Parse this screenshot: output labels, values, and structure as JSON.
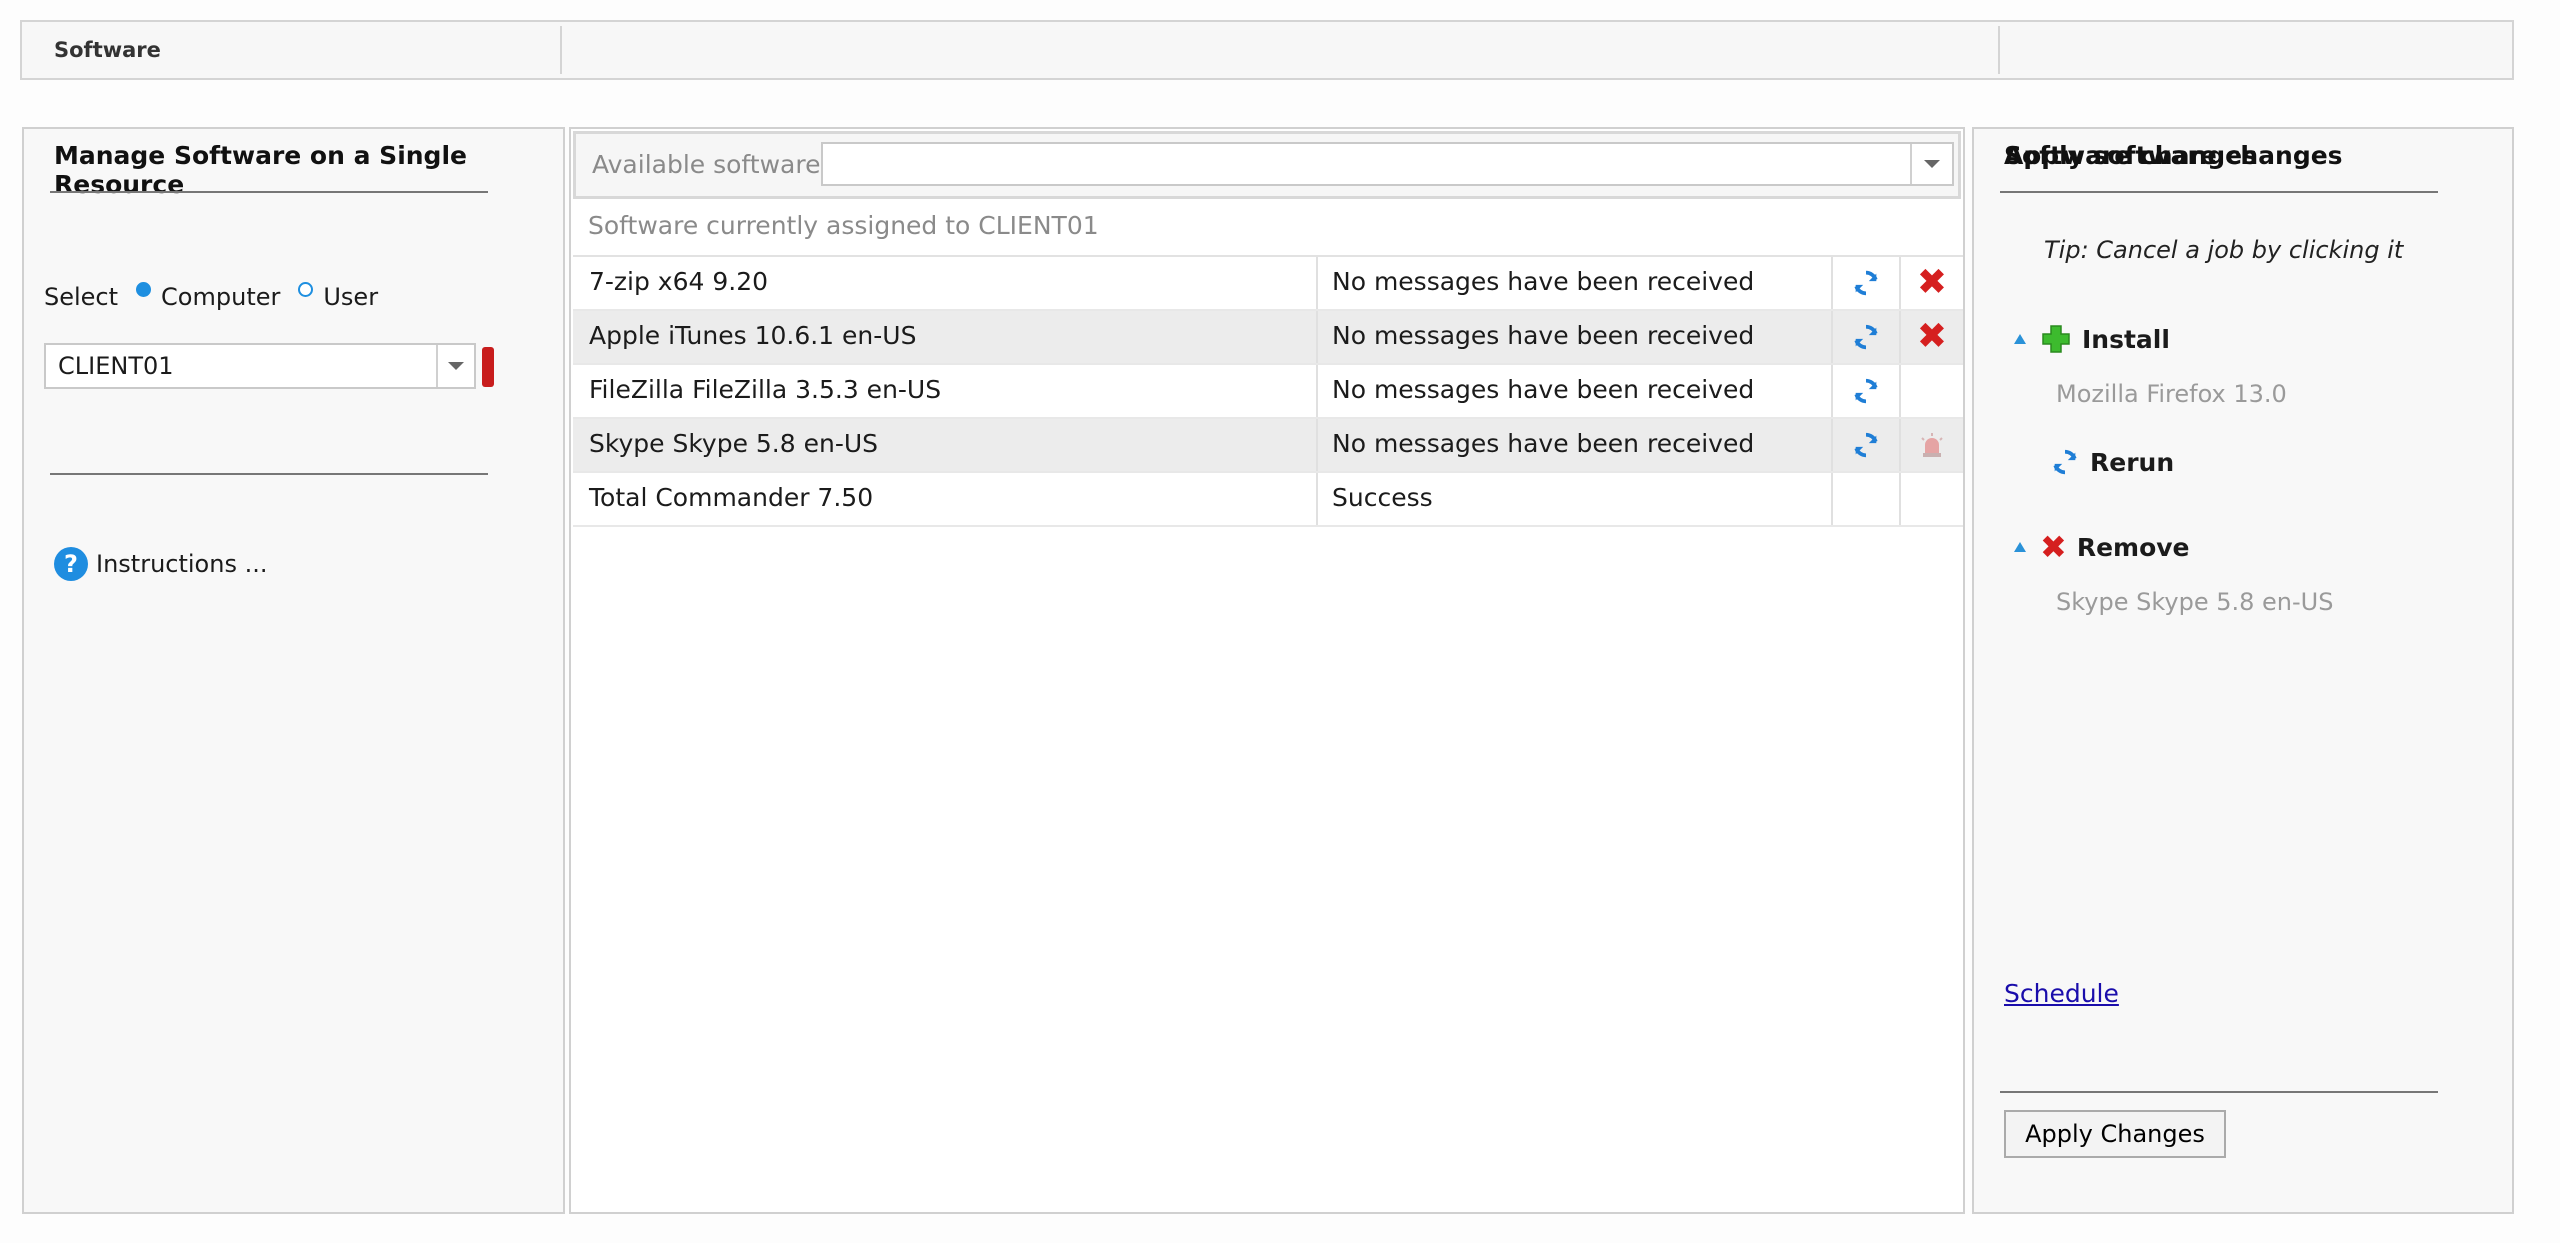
{
  "topbar": {
    "title": "Software"
  },
  "left": {
    "heading": "Manage Software on a Single Resource",
    "select_label": "Select",
    "radio_computer": "Computer",
    "radio_user": "User",
    "resource_value": "CLIENT01",
    "instructions": "Instructions ..."
  },
  "middle": {
    "available_label": "Available software",
    "available_value": "",
    "assigned_caption": "Software currently assigned to CLIENT01",
    "rows": [
      {
        "name": "7-zip x64 9.20",
        "status": "No messages have been received"
      },
      {
        "name": "Apple iTunes 10.6.1 en-US",
        "status": "No messages have been received"
      },
      {
        "name": "FileZilla FileZilla 3.5.3 en-US",
        "status": "No messages have been received"
      },
      {
        "name": "Skype Skype 5.8 en-US",
        "status": "No messages have been received"
      },
      {
        "name": "Total Commander 7.50",
        "status": "Success"
      }
    ]
  },
  "right": {
    "heading": "Software changes",
    "tip": "Tip: Cancel a job by clicking it",
    "install_label": "Install",
    "install_item": "Mozilla Firefox 13.0",
    "rerun_label": "Rerun",
    "remove_label": "Remove",
    "remove_item": "Skype Skype 5.8 en-US",
    "schedule_link": "Schedule",
    "apply_heading": "Apply software changes",
    "apply_button": "Apply Changes"
  },
  "colors": {
    "accent": "#1e8fe0",
    "remove_red": "#d51f1f",
    "install_green": "#3dbb2e"
  }
}
